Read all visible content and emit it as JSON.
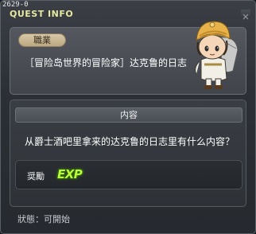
{
  "window": {
    "quest_id": "2629-0",
    "title": "QUEST INFO"
  },
  "info": {
    "job_tag": "職業",
    "quest_name": "［冒险岛世界的冒险家］达克鲁的日志"
  },
  "content": {
    "header": "内容",
    "text": "从爵士酒吧里拿来的达克鲁的日志里有什么内容？",
    "reward_label": "奨勵",
    "reward_exp": "EXP"
  },
  "status": {
    "label": "狀態：可開始"
  },
  "colors": {
    "title": "#e6e8a0",
    "exp": "#b8ff3a",
    "tag": "#d8c8a8"
  },
  "icons": {
    "npc": "npc-character-portrait",
    "close": "close-icon"
  }
}
